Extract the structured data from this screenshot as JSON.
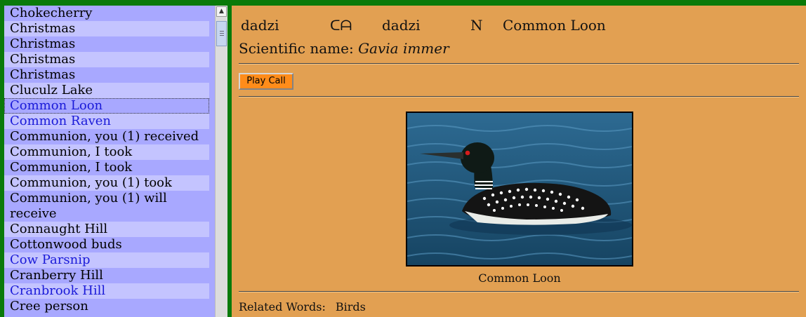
{
  "word_list": [
    {
      "label": "Chokecherry",
      "link": false
    },
    {
      "label": "Christmas",
      "link": false
    },
    {
      "label": "Christmas",
      "link": false
    },
    {
      "label": "Christmas",
      "link": false
    },
    {
      "label": "Christmas",
      "link": false
    },
    {
      "label": "Cluculz Lake",
      "link": false
    },
    {
      "label": "Common Loon",
      "link": true,
      "selected": true
    },
    {
      "label": "Common Raven",
      "link": true
    },
    {
      "label": "Communion, you (1) received",
      "link": false
    },
    {
      "label": "Communion, I took",
      "link": false
    },
    {
      "label": "Communion, I took",
      "link": false
    },
    {
      "label": "Communion, you (1) took",
      "link": false
    },
    {
      "label": "Communion, you (1) will receive",
      "link": false
    },
    {
      "label": "Connaught Hill",
      "link": false
    },
    {
      "label": "Cottonwood buds",
      "link": false
    },
    {
      "label": "Cow Parsnip",
      "link": true
    },
    {
      "label": "Cranberry Hill",
      "link": false
    },
    {
      "label": "Cranbrook Hill",
      "link": true
    },
    {
      "label": "Cree person",
      "link": false
    }
  ],
  "scrollbar": {
    "up_arrow": "▲"
  },
  "entry": {
    "word1": "dadzi",
    "sound_glyph": "ᑕᗩ",
    "word2": "dadzi",
    "pos": "N",
    "english": "Common Loon",
    "sci_label": "Scientific name:",
    "sci_name": "Gavia immer",
    "play_label": "Play Call",
    "photo_caption": "Common Loon",
    "related_label": "Related Words:",
    "related_value": "Birds"
  },
  "colors": {
    "frame_green": "#0a7a0a",
    "list_bg": "#a8a8ff",
    "content_bg": "#e2a052",
    "link": "#1a1ad8",
    "button": "#ff8c1a"
  },
  "icons": {
    "loon": "common-loon-photo"
  }
}
